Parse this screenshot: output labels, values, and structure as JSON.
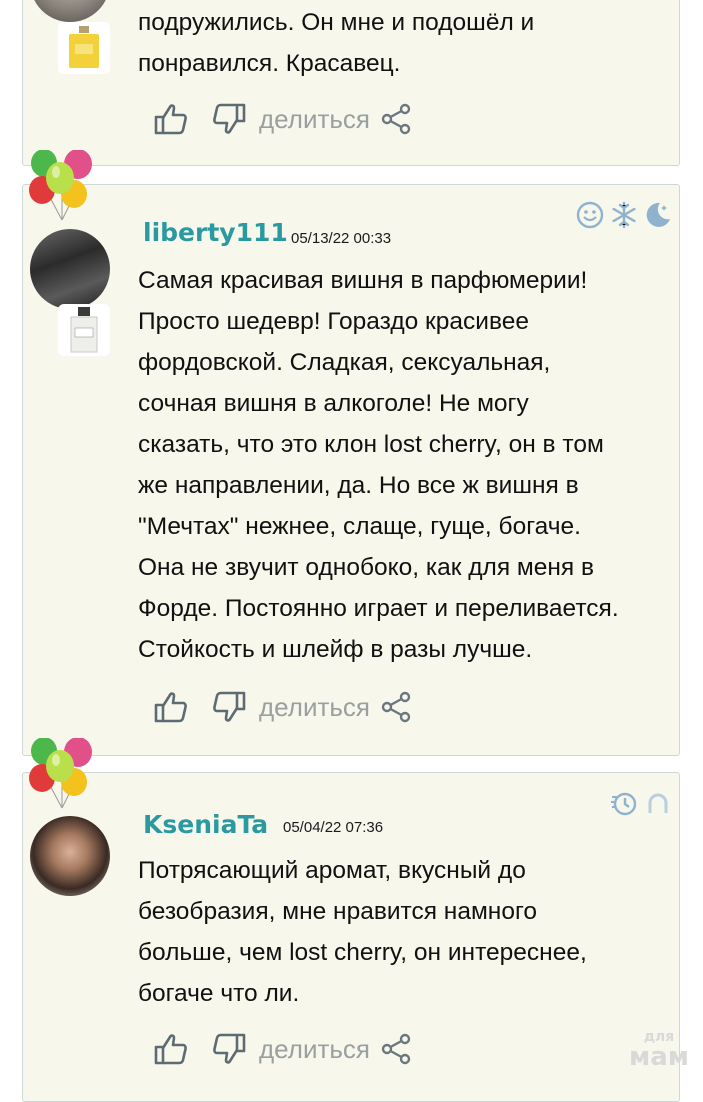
{
  "share_label": "делиться",
  "posts": [
    {
      "text_lines": [
        "подружились. Он мне и подошёл и",
        "понравился. Красавец."
      ]
    },
    {
      "username": "liberty111",
      "date": "05/13/22 00:33",
      "text_lines": [
        "Самая красивая вишня в парфюмерии!",
        "Просто шедевр! Гораздо красивее",
        "фордовской. Сладкая, сексуальная,",
        "сочная вишня в алкоголе! Не могу",
        "сказать, что это клон lost cherry, он в том",
        "же направлении, да. Но все ж вишня в",
        "\"Мечтах\" нежнее, слаще, гуще, богаче.",
        "Она не звучит однобоко, как для меня в",
        "Форде. Постоянно играет и переливается.",
        "Стойкость и шлейф в разы лучше."
      ]
    },
    {
      "username": "KseniaTa",
      "date": "05/04/22 07:36",
      "text_lines": [
        "Потрясающий аромат, вкусный до",
        "безобразия, мне нравится намного",
        "больше, чем lost cherry, он интереснее,",
        "богаче что ли."
      ]
    }
  ],
  "watermark": {
    "top": "для",
    "bottom": "мам"
  },
  "colors": {
    "username": "#2b9aa0",
    "card_bg": "#f7f7ec",
    "icon": "#5f6b73",
    "badge": "#8fb3cf"
  }
}
